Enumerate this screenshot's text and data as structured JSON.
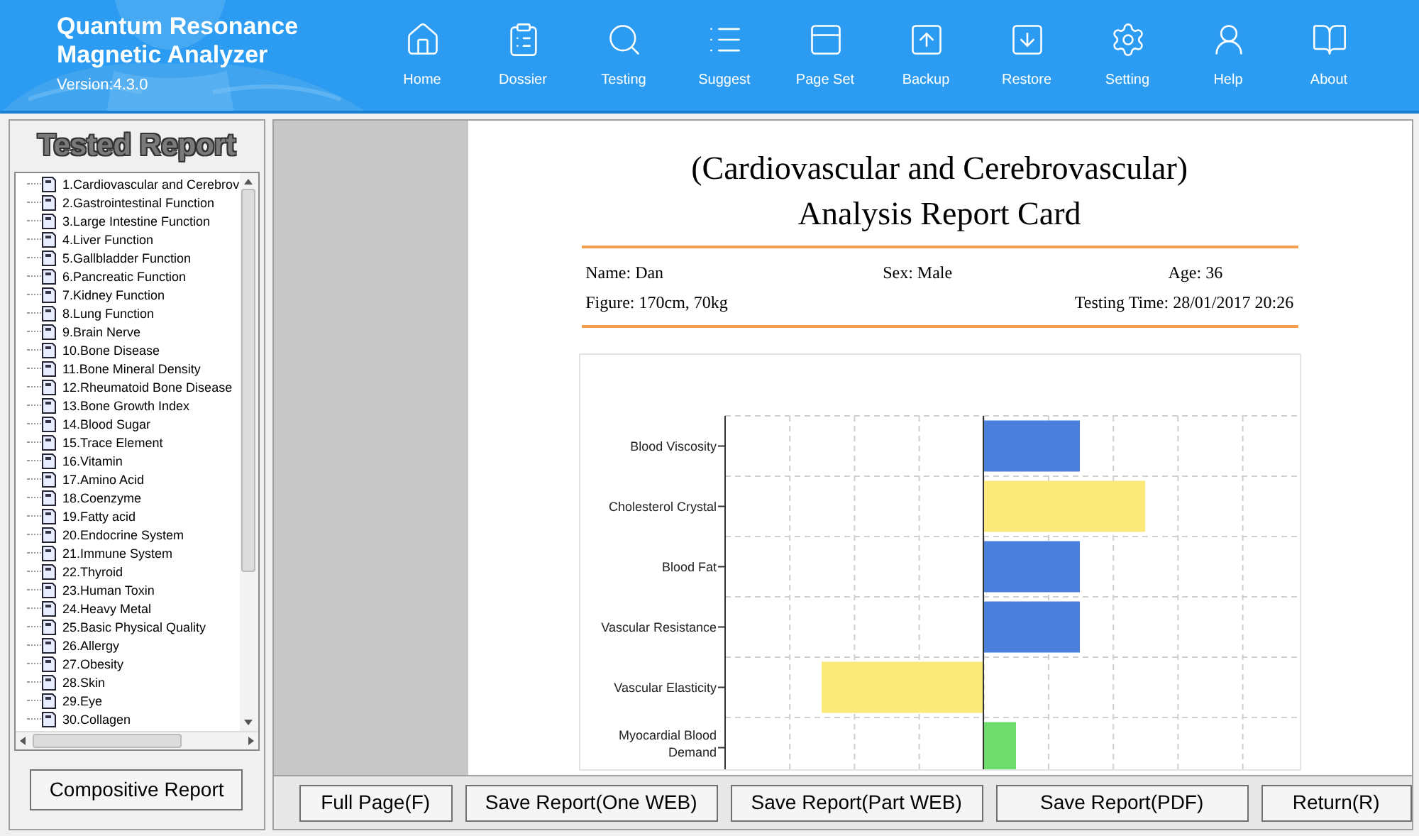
{
  "app": {
    "title_line1": "Quantum Resonance",
    "title_line2": "Magnetic Analyzer",
    "version": "Version:4.3.0"
  },
  "toolbar": [
    {
      "label": "Home"
    },
    {
      "label": "Dossier"
    },
    {
      "label": "Testing"
    },
    {
      "label": "Suggest"
    },
    {
      "label": "Page Set"
    },
    {
      "label": "Backup"
    },
    {
      "label": "Restore"
    },
    {
      "label": "Setting"
    },
    {
      "label": "Help"
    },
    {
      "label": "About"
    }
  ],
  "sidebar": {
    "title": "Tested Report",
    "items": [
      "1.Cardiovascular and Cerebrov",
      "2.Gastrointestinal Function",
      "3.Large Intestine Function",
      "4.Liver Function",
      "5.Gallbladder Function",
      "6.Pancreatic Function",
      "7.Kidney Function",
      "8.Lung Function",
      "9.Brain Nerve",
      "10.Bone Disease",
      "11.Bone Mineral Density",
      "12.Rheumatoid Bone Disease",
      "13.Bone Growth Index",
      "14.Blood Sugar",
      "15.Trace Element",
      "16.Vitamin",
      "17.Amino Acid",
      "18.Coenzyme",
      "19.Fatty acid",
      "20.Endocrine System",
      "21.Immune System",
      "22.Thyroid",
      "23.Human Toxin",
      "24.Heavy Metal",
      "25.Basic Physical Quality",
      "26.Allergy",
      "27.Obesity",
      "28.Skin",
      "29.Eye",
      "30.Collagen"
    ],
    "button": "Compositive Report"
  },
  "report": {
    "title_line1": "(Cardiovascular and Cerebrovascular)",
    "title_line2": "Analysis Report Card",
    "name": "Name: Dan",
    "sex": "Sex: Male",
    "age": "Age: 36",
    "figure": "Figure: 170cm, 70kg",
    "testing_time": "Testing Time: 28/01/2017 20:26",
    "chart_rows": [
      {
        "label": "Blood Viscosity",
        "color": "#4a7fdc"
      },
      {
        "label": "Cholesterol Crystal",
        "color": "#fbe97a"
      },
      {
        "label": "Blood Fat",
        "color": "#4a7fdc"
      },
      {
        "label": "Vascular Resistance",
        "color": "#4a7fdc"
      },
      {
        "label": "Vascular Elasticity",
        "color": "#fbe97a"
      },
      {
        "label": "Myocardial Blood Demand",
        "color": "#6ddc6d"
      }
    ]
  },
  "buttons": [
    "Full Page(F)",
    "Save Report(One WEB)",
    "Save Report(Part WEB)",
    "Save Report(PDF)",
    "Return(R)"
  ]
}
